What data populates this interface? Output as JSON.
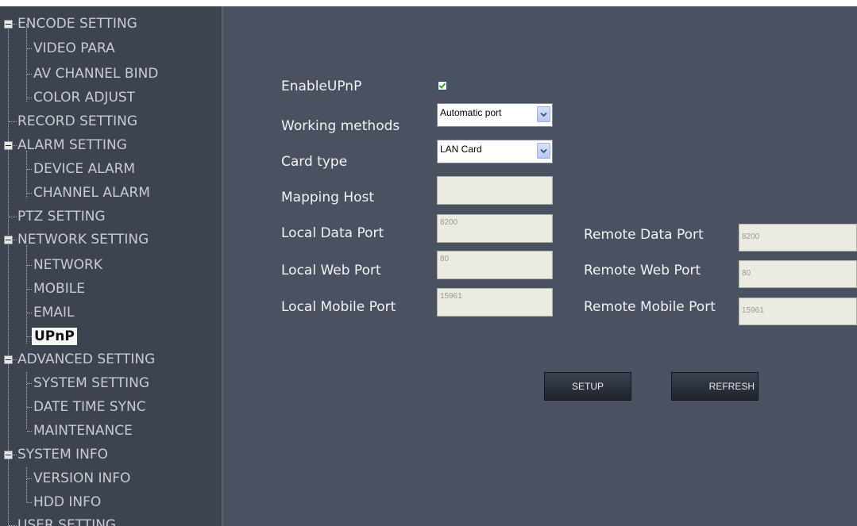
{
  "sidebar": {
    "items": [
      {
        "label": "ENCODE SETTING"
      },
      {
        "label": "VIDEO PARA"
      },
      {
        "label": "AV CHANNEL BIND"
      },
      {
        "label": "COLOR ADJUST"
      },
      {
        "label": "RECORD SETTING"
      },
      {
        "label": "ALARM SETTING"
      },
      {
        "label": "DEVICE ALARM"
      },
      {
        "label": "CHANNEL ALARM"
      },
      {
        "label": "PTZ SETTING"
      },
      {
        "label": "NETWORK SETTING"
      },
      {
        "label": "NETWORK"
      },
      {
        "label": "MOBILE"
      },
      {
        "label": "EMAIL"
      },
      {
        "label": "UPnP"
      },
      {
        "label": "ADVANCED SETTING"
      },
      {
        "label": "SYSTEM SETTING"
      },
      {
        "label": "DATE TIME SYNC"
      },
      {
        "label": "MAINTENANCE"
      },
      {
        "label": "SYSTEM INFO"
      },
      {
        "label": "VERSION INFO"
      },
      {
        "label": "HDD INFO"
      },
      {
        "label": "USER SETTING"
      }
    ],
    "selected": "UPnP"
  },
  "form": {
    "enable_upnp": {
      "label": "EnableUPnP",
      "checked": true
    },
    "working_methods": {
      "label": "Working methods",
      "value": "Automatic port"
    },
    "card_type": {
      "label": "Card type",
      "value": "LAN Card"
    },
    "mapping_host": {
      "label": "Mapping Host",
      "value": ""
    },
    "local_data_port": {
      "label": "Local Data Port",
      "value": "8200"
    },
    "local_web_port": {
      "label": "Local Web Port",
      "value": "80"
    },
    "local_mobile_port": {
      "label": "Local Mobile Port",
      "value": "15961"
    },
    "remote_data_port": {
      "label": "Remote Data Port",
      "value": "8200"
    },
    "remote_web_port": {
      "label": "Remote Web Port",
      "value": "80"
    },
    "remote_mobile_port": {
      "label": "Remote Mobile Port",
      "value": "15961"
    }
  },
  "buttons": {
    "setup": "SETUP",
    "refresh": "REFRESH"
  },
  "colors": {
    "sidebar_bg": "#3d4450",
    "main_bg": "#4a5261",
    "checkbox_check": "#2a9a2a"
  }
}
